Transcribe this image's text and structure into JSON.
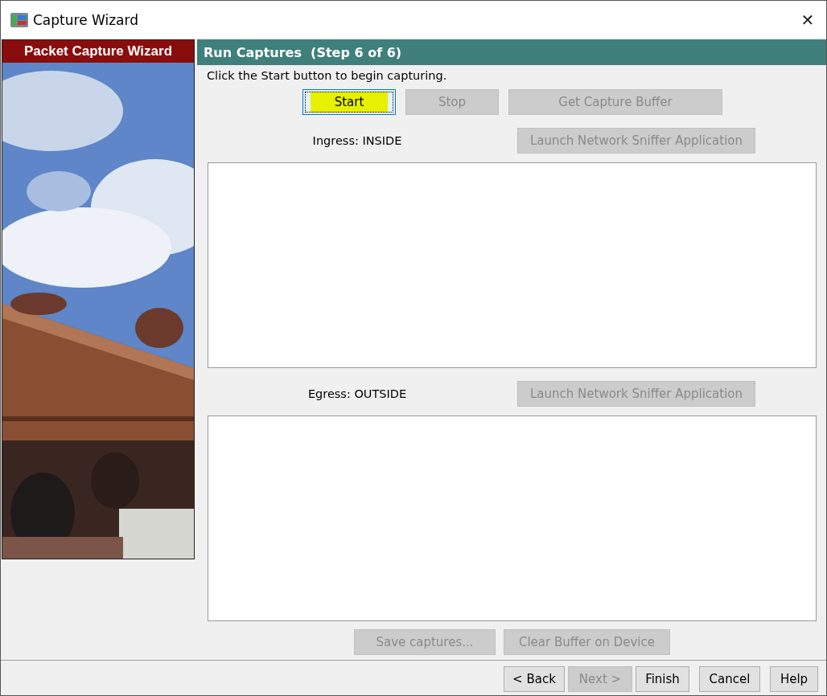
{
  "window": {
    "title": "Capture Wizard",
    "close": "✕"
  },
  "sidebar": {
    "banner": "Packet Capture Wizard"
  },
  "step": {
    "title": "Run Captures  (Step 6 of 6)",
    "instruction": "Click the Start button to begin capturing."
  },
  "capture_buttons": [
    {
      "label": "Start",
      "disabled": false,
      "highlighted": true
    },
    {
      "label": "Stop",
      "disabled": true,
      "highlighted": false
    },
    {
      "label": "Get Capture Buffer",
      "disabled": true,
      "highlighted": false
    }
  ],
  "captures": [
    {
      "label": "Ingress: INSIDE",
      "button": {
        "label": "Launch Network Sniffer Application",
        "disabled": true
      }
    },
    {
      "label": "Egress: OUTSIDE",
      "button": {
        "label": "Launch Network Sniffer Application",
        "disabled": true
      }
    }
  ],
  "buffer_buttons": [
    {
      "label": "Save captures...",
      "disabled": true
    },
    {
      "label": "Clear Buffer on Device",
      "disabled": true
    }
  ],
  "nav_buttons": [
    {
      "label": "< Back",
      "disabled": false
    },
    {
      "label": "Next >",
      "disabled": true
    },
    {
      "label": "Finish",
      "disabled": false
    },
    {
      "label": "Cancel",
      "disabled": false
    },
    {
      "label": "Help",
      "disabled": false
    }
  ]
}
